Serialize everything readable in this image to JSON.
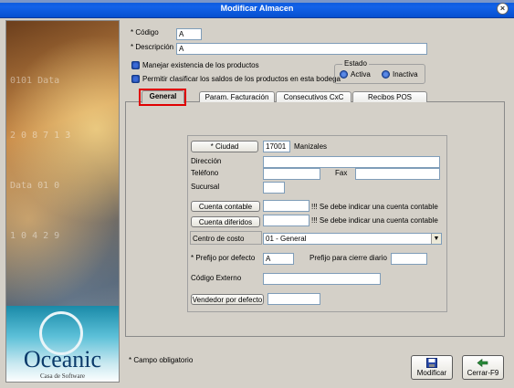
{
  "window": {
    "title": "Modificar Almacen",
    "close_glyph": "×"
  },
  "left_panel": {
    "logo_name": "Oceanic",
    "logo_subtitle": "Casa de Software"
  },
  "header": {
    "codigo_label": "* Código",
    "codigo_value": "A",
    "descripcion_label": "* Descripción",
    "descripcion_value": "A",
    "chk_existencia_label": "Manejar existencia de los productos",
    "chk_clasificar_label": "Permitir clasificar los saldos de los productos en esta bodega",
    "estado": {
      "title": "Estado",
      "activa": "Activa",
      "inactiva": "Inactiva"
    }
  },
  "tabs": [
    {
      "label": "General"
    },
    {
      "label": "Param. Facturación"
    },
    {
      "label": "Consecutivos CxC"
    },
    {
      "label": "Recibos POS"
    }
  ],
  "general": {
    "ciudad_button": "* Ciudad",
    "ciudad_code": "17001",
    "ciudad_name": "Manizales",
    "direccion_label": "Dirección",
    "direccion_value": "",
    "telefono_label": "Teléfono",
    "telefono_value": "",
    "fax_label": "Fax",
    "fax_value": "",
    "sucursal_label": "Sucursal",
    "sucursal_value": "",
    "cuenta_contable_button": "Cuenta contable",
    "cuenta_contable_value": "",
    "cuenta_contable_warning": "!!! Se debe indicar una cuenta contable",
    "cuenta_diferidos_button": "Cuenta diferidos",
    "cuenta_diferidos_value": "",
    "cuenta_diferidos_warning": "!!! Se debe indicar una cuenta contable",
    "centro_costo_label": "Centro de costo",
    "centro_costo_value": "01 - General",
    "prefijo_defecto_label": "* Prefijo por defecto",
    "prefijo_defecto_value": "A",
    "prefijo_cierre_label": "Prefijo para cierre diario",
    "prefijo_cierre_value": "",
    "codigo_externo_label": "Código Externo",
    "codigo_externo_value": "",
    "vendedor_button": "Vendedor por defecto",
    "vendedor_value": ""
  },
  "footer": {
    "required_note": "* Campo obligatorio",
    "modificar_label": "Modificar",
    "cerrar_label": "Cerrar-F9"
  },
  "colors": {
    "accent": "#0a58d8",
    "highlight_box": "#e00000"
  }
}
